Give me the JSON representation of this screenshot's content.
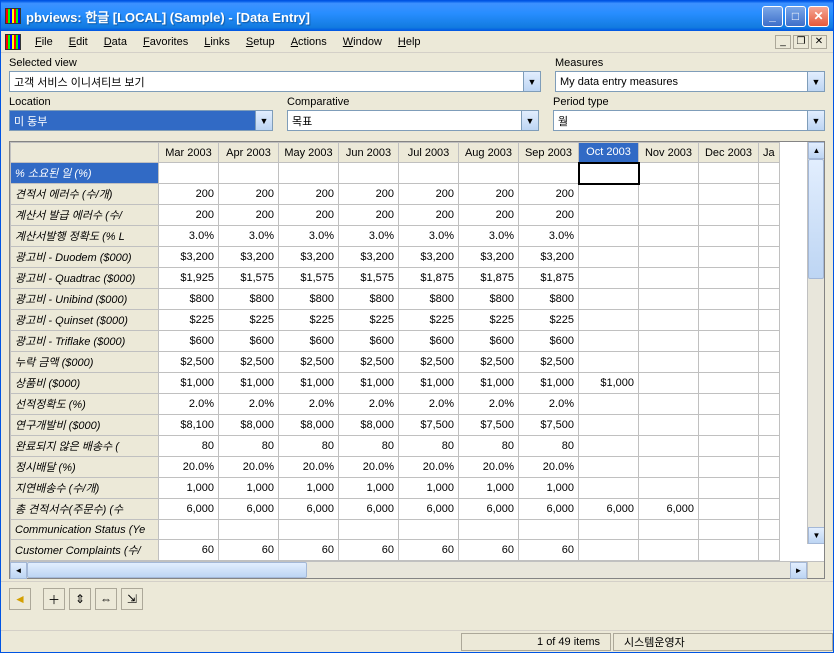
{
  "title": "pbviews: 한글 [LOCAL] (Sample) - [Data Entry]",
  "menu": [
    "File",
    "Edit",
    "Data",
    "Favorites",
    "Links",
    "Setup",
    "Actions",
    "Window",
    "Help"
  ],
  "labels": {
    "selected_view": "Selected view",
    "measures": "Measures",
    "location": "Location",
    "comparative": "Comparative",
    "period_type": "Period type"
  },
  "values": {
    "selected_view": "고객 서비스 이니셔티브 보기",
    "measures": "My data entry measures",
    "location": "미 동부",
    "comparative": "목표",
    "period_type": "월"
  },
  "columns": [
    "Mar 2003",
    "Apr 2003",
    "May 2003",
    "Jun 2003",
    "Jul 2003",
    "Aug 2003",
    "Sep 2003",
    "Oct 2003",
    "Nov 2003",
    "Dec 2003",
    "Ja"
  ],
  "active_col": 7,
  "rows": [
    {
      "label": "% 소요된 일 (%)",
      "active": true,
      "cells": [
        "",
        "",
        "",
        "",
        "",
        "",
        "",
        "",
        "",
        "",
        ""
      ]
    },
    {
      "label": "견적서 에러수 (수/개)",
      "cells": [
        "200",
        "200",
        "200",
        "200",
        "200",
        "200",
        "200",
        "",
        "",
        "",
        ""
      ]
    },
    {
      "label": "계산서 발급 에러수 (수/",
      "cells": [
        "200",
        "200",
        "200",
        "200",
        "200",
        "200",
        "200",
        "",
        "",
        "",
        ""
      ]
    },
    {
      "label": "계산서발행 정확도 (% L",
      "cells": [
        "3.0%",
        "3.0%",
        "3.0%",
        "3.0%",
        "3.0%",
        "3.0%",
        "3.0%",
        "",
        "",
        "",
        ""
      ]
    },
    {
      "label": "광고비 - Duodem ($000)",
      "cells": [
        "$3,200",
        "$3,200",
        "$3,200",
        "$3,200",
        "$3,200",
        "$3,200",
        "$3,200",
        "",
        "",
        "",
        ""
      ]
    },
    {
      "label": "광고비 - Quadtrac ($000)",
      "cells": [
        "$1,925",
        "$1,575",
        "$1,575",
        "$1,575",
        "$1,875",
        "$1,875",
        "$1,875",
        "",
        "",
        "",
        ""
      ]
    },
    {
      "label": "광고비 - Unibind ($000)",
      "cells": [
        "$800",
        "$800",
        "$800",
        "$800",
        "$800",
        "$800",
        "$800",
        "",
        "",
        "",
        ""
      ]
    },
    {
      "label": "광고비 - Quinset ($000)",
      "cells": [
        "$225",
        "$225",
        "$225",
        "$225",
        "$225",
        "$225",
        "$225",
        "",
        "",
        "",
        ""
      ]
    },
    {
      "label": "광고비 - Triflake ($000)",
      "cells": [
        "$600",
        "$600",
        "$600",
        "$600",
        "$600",
        "$600",
        "$600",
        "",
        "",
        "",
        ""
      ]
    },
    {
      "label": "누락 금액 ($000)",
      "cells": [
        "$2,500",
        "$2,500",
        "$2,500",
        "$2,500",
        "$2,500",
        "$2,500",
        "$2,500",
        "",
        "",
        "",
        ""
      ]
    },
    {
      "label": "상품비 ($000)",
      "cells": [
        "$1,000",
        "$1,000",
        "$1,000",
        "$1,000",
        "$1,000",
        "$1,000",
        "$1,000",
        "$1,000",
        "",
        "",
        ""
      ]
    },
    {
      "label": "선적정확도 (%)",
      "cells": [
        "2.0%",
        "2.0%",
        "2.0%",
        "2.0%",
        "2.0%",
        "2.0%",
        "2.0%",
        "",
        "",
        "",
        ""
      ]
    },
    {
      "label": "연구개발비 ($000)",
      "cells": [
        "$8,100",
        "$8,000",
        "$8,000",
        "$8,000",
        "$7,500",
        "$7,500",
        "$7,500",
        "",
        "",
        "",
        ""
      ]
    },
    {
      "label": "완료되지 않은 배송수 (",
      "cells": [
        "80",
        "80",
        "80",
        "80",
        "80",
        "80",
        "80",
        "",
        "",
        "",
        ""
      ]
    },
    {
      "label": "정시배달 (%)",
      "cells": [
        "20.0%",
        "20.0%",
        "20.0%",
        "20.0%",
        "20.0%",
        "20.0%",
        "20.0%",
        "",
        "",
        "",
        ""
      ]
    },
    {
      "label": "지연배송수 (수/개)",
      "cells": [
        "1,000",
        "1,000",
        "1,000",
        "1,000",
        "1,000",
        "1,000",
        "1,000",
        "",
        "",
        "",
        ""
      ]
    },
    {
      "label": "총 견적서수(주문수) (수",
      "cells": [
        "6,000",
        "6,000",
        "6,000",
        "6,000",
        "6,000",
        "6,000",
        "6,000",
        "6,000",
        "6,000",
        "",
        ""
      ]
    },
    {
      "label": "Communication Status (Ye",
      "cells": [
        "",
        "",
        "",
        "",
        "",
        "",
        "",
        "",
        "",
        "",
        ""
      ]
    },
    {
      "label": "Customer Complaints (수/",
      "cells": [
        "60",
        "60",
        "60",
        "60",
        "60",
        "60",
        "60",
        "",
        "",
        "",
        ""
      ]
    }
  ],
  "status": {
    "items": "1 of 49 items",
    "user": "시스템운영자"
  },
  "icons": {
    "back": "◄",
    "add": "＋",
    "expand_v": "⇕",
    "expand_h": "⇔",
    "expand": "⇲"
  }
}
